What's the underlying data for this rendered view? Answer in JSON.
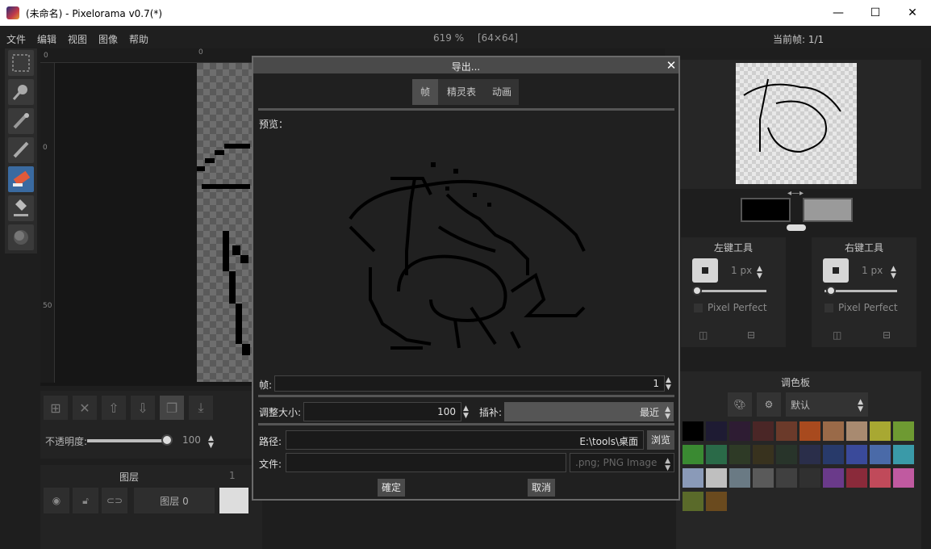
{
  "window": {
    "title": "(未命名) - Pixelorama v0.7(*)",
    "minimize": "—",
    "maximize": "☐",
    "close": "✕"
  },
  "menu": {
    "items": [
      "文件",
      "编辑",
      "视图",
      "图像",
      "帮助"
    ],
    "zoom": "619 %",
    "canvas_size": "[64×64]",
    "current_frame": "当前帧: 1/1"
  },
  "ruler": {
    "top_marks": [
      "0",
      "0"
    ],
    "left_marks": [
      "0",
      "50"
    ]
  },
  "animation": {
    "opacity_label": "不透明度:",
    "opacity_value": "100"
  },
  "layers": {
    "title": "图层",
    "frame_col": "1",
    "layer_name": "图层 0"
  },
  "right": {
    "left_tool": {
      "title": "左键工具",
      "size": "1 px",
      "pixel_perfect": "Pixel Perfect"
    },
    "right_tool": {
      "title": "右键工具",
      "size": "1 px",
      "pixel_perfect": "Pixel Perfect"
    },
    "palette": {
      "title": "调色板",
      "selected": "默认",
      "swatches": [
        "#000000",
        "#1e1b33",
        "#2e1c33",
        "#4a2626",
        "#6b3a2a",
        "#a84a1e",
        "#9a6a48",
        "#a88a70",
        "#a8a832",
        "#6e9a32",
        "#3a8a32",
        "#2a6a48",
        "#2e3a26",
        "#38321e",
        "#28342a",
        "#2a2e4a",
        "#283a6a",
        "#3a4a9a",
        "#4a6aa8",
        "#3a9aa8",
        "#8a9ab8",
        "#bfbfbf",
        "#6a7a84",
        "#5a5a5a",
        "#404040",
        "#303030",
        "#6a3a8a",
        "#8a2a3a",
        "#c04a5a",
        "#c05aa0",
        "#5a6a2a",
        "#6a4a1e"
      ]
    }
  },
  "dialog": {
    "title": "导出...",
    "close": "✕",
    "tabs": [
      "帧",
      "精灵表",
      "动画"
    ],
    "active_tab": "帧",
    "preview_label": "预览：",
    "frame_label": "帧:",
    "frame_value": "1",
    "resize_label": "调整大小:",
    "resize_value": "100",
    "interp_label": "插补:",
    "interp_value": "最近",
    "path_label": "路径:",
    "path_value": "E:\\tools\\桌面",
    "browse": "浏览",
    "file_label": "文件:",
    "file_value": "",
    "file_type": ".png; PNG Image",
    "confirm": "確定",
    "cancel": "取消"
  }
}
